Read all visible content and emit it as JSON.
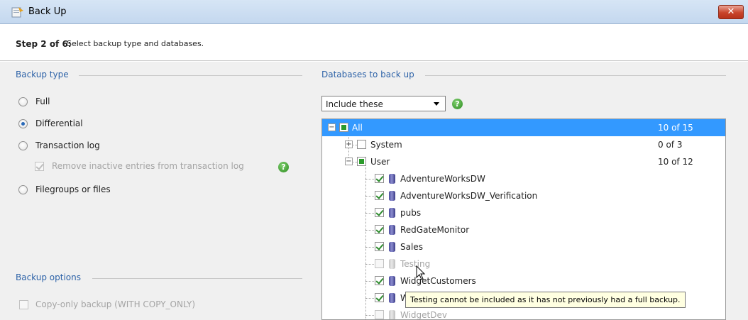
{
  "window": {
    "title": "Back Up",
    "close_label": "✕",
    "close_color": "#c9442b"
  },
  "step": {
    "number": "Step 2 of 6:",
    "description": "Select backup type and databases."
  },
  "backup_type": {
    "title": "Backup type",
    "options": [
      {
        "label": "Full",
        "selected": false
      },
      {
        "label": "Differential",
        "selected": true
      },
      {
        "label": "Transaction log",
        "selected": false
      },
      {
        "label": "Filegroups or files",
        "selected": false
      }
    ],
    "remove_inactive": {
      "label": "Remove inactive entries from transaction log",
      "checked": true,
      "enabled": false
    }
  },
  "backup_options": {
    "title": "Backup options",
    "copy_only": {
      "label": "Copy-only backup (WITH COPY_ONLY)",
      "checked": false,
      "enabled": false
    }
  },
  "databases": {
    "title": "Databases to back up",
    "filter_value": "Include these",
    "tree": [
      {
        "label": "All",
        "count": "10 of 15",
        "state": "partial",
        "selected": true
      },
      {
        "label": "System",
        "count": "0 of 3",
        "state": "unchecked"
      },
      {
        "label": "User",
        "count": "10 of 12",
        "state": "partial"
      },
      {
        "label": "AdventureWorksDW",
        "state": "checked"
      },
      {
        "label": "AdventureWorksDW_Verification",
        "state": "checked"
      },
      {
        "label": "pubs",
        "state": "checked"
      },
      {
        "label": "RedGateMonitor",
        "state": "checked"
      },
      {
        "label": "Sales",
        "state": "checked"
      },
      {
        "label": "Testing",
        "state": "disabled"
      },
      {
        "label": "WidgetCustomers",
        "state": "checked"
      },
      {
        "label": "Wid",
        "state": "checked"
      },
      {
        "label": "WidgetDev",
        "state": "disabled"
      }
    ]
  },
  "tooltip": {
    "text": "Testing cannot be included as it has not previously had a full backup."
  },
  "help_glyph": "?",
  "colors": {
    "accent": "#2e63a8",
    "selection": "#3399ff",
    "help": "#2b8a1f"
  }
}
